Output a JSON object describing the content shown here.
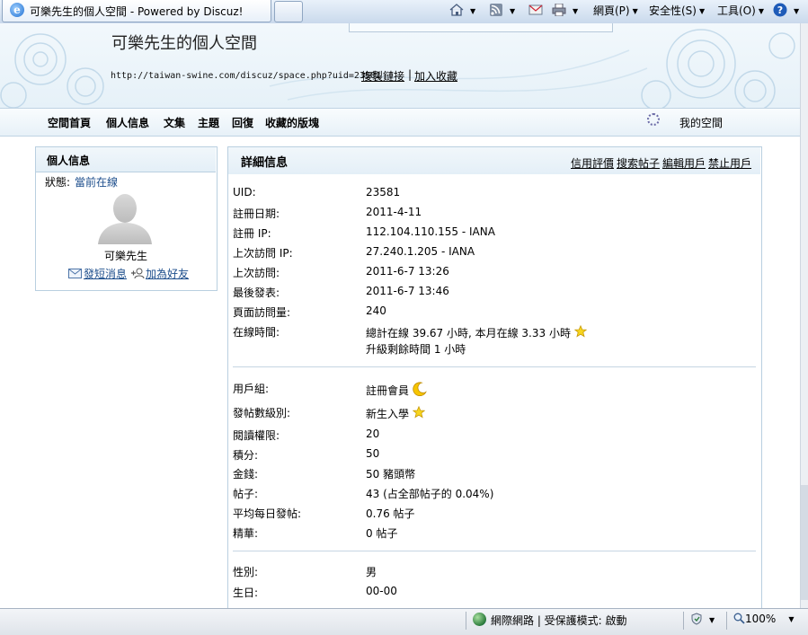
{
  "browser": {
    "tab_title": "可樂先生的個人空間 - Powered by Discuz!",
    "toolbar": {
      "page_menu": "網頁(P)",
      "safety_menu": "安全性(S)",
      "tools_menu": "工具(O)"
    },
    "status": {
      "zone": "網際網路 | 受保護模式: 啟動",
      "zoom": "100%"
    }
  },
  "header": {
    "space_title": "可樂先生的個人空間",
    "url": "http://taiwan-swine.com/discuz/space.php?uid=23581",
    "copy_link": "複製鏈接",
    "separator": "|",
    "add_favorite": "加入收藏"
  },
  "nav": {
    "items": [
      "空間首頁",
      "個人信息",
      "文集",
      "主題",
      "回復",
      "收藏的版塊"
    ],
    "my_space": "我的空間"
  },
  "profile_card": {
    "title": "個人信息",
    "status_label": "狀態:",
    "status_value": "當前在線",
    "username": "可樂先生",
    "send_pm": "發短消息",
    "add_friend": "加為好友"
  },
  "details": {
    "title": "詳細信息",
    "actions": [
      "信用評價",
      "搜索帖子",
      "編輯用戶",
      "禁止用戶"
    ],
    "section1": [
      {
        "label": "UID:",
        "value": "23581"
      },
      {
        "label": "註冊日期:",
        "value": "2011-4-11"
      },
      {
        "label": "註冊 IP:",
        "value": "112.104.110.155 - IANA"
      },
      {
        "label": "上次訪問 IP:",
        "value": "27.240.1.205 - IANA"
      },
      {
        "label": "上次訪問:",
        "value": "2011-6-7 13:26"
      },
      {
        "label": "最後發表:",
        "value": "2011-6-7 13:46"
      },
      {
        "label": "頁面訪問量:",
        "value": "240"
      }
    ],
    "online_time": {
      "label": "在線時間:",
      "line1": "總計在線 39.67 小時, 本月在線 3.33 小時",
      "line2": "升級剩餘時間 1 小時"
    },
    "section2": [
      {
        "label": "用戶組:",
        "value": "註冊會員",
        "icon": "moon-icon"
      },
      {
        "label": "發帖數級別:",
        "value": "新生入學",
        "icon": "star-icon"
      },
      {
        "label": "閱讀權限:",
        "value": "20"
      },
      {
        "label": "積分:",
        "value": "50"
      },
      {
        "label": "金錢:",
        "value": "50 豬頭幣"
      },
      {
        "label": "帖子:",
        "value": "43 (占全部帖子的 0.04%)"
      },
      {
        "label": "平均每日發帖:",
        "value": "0.76 帖子"
      },
      {
        "label": "精華:",
        "value": "0 帖子"
      }
    ],
    "section3": [
      {
        "label": "性別:",
        "value": "男"
      },
      {
        "label": "生日:",
        "value": "00-00"
      }
    ]
  }
}
